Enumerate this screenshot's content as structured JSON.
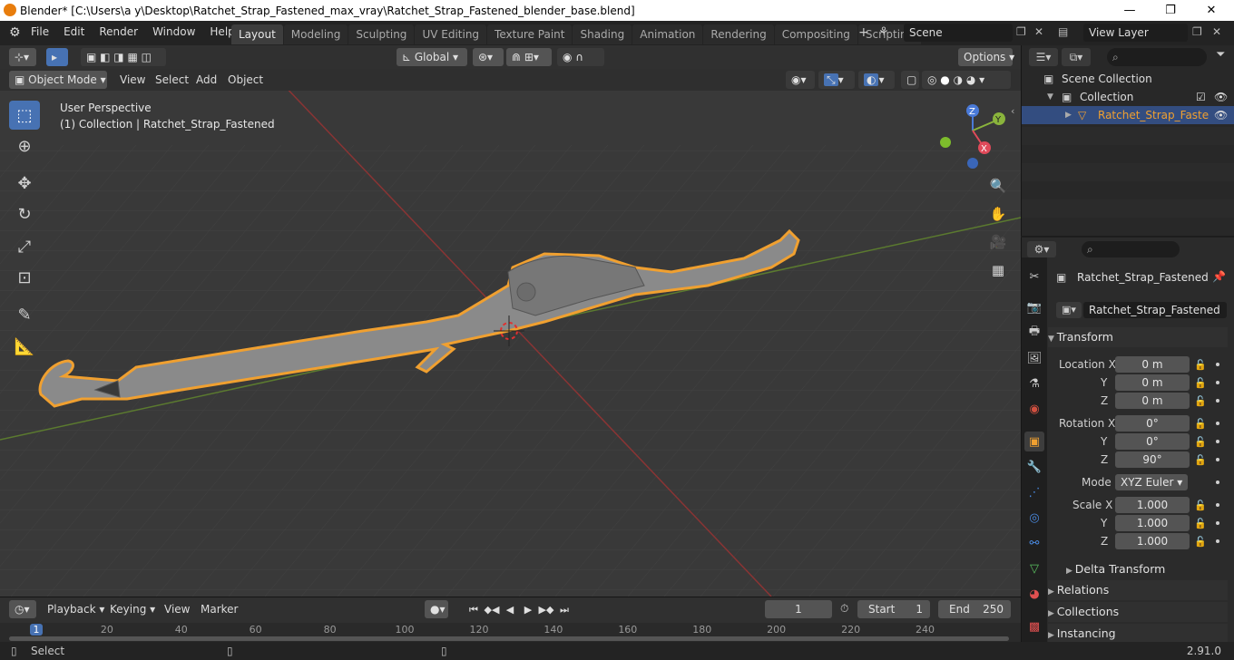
{
  "window": {
    "title": "Blender* [C:\\Users\\a y\\Desktop\\Ratchet_Strap_Fastened_max_vray\\Ratchet_Strap_Fastened_blender_base.blend]",
    "minimize": "—",
    "maximize": "❐",
    "close": "✕"
  },
  "menu": [
    "File",
    "Edit",
    "Render",
    "Window",
    "Help"
  ],
  "workspaces": [
    "Layout",
    "Modeling",
    "Sculpting",
    "UV Editing",
    "Texture Paint",
    "Shading",
    "Animation",
    "Rendering",
    "Compositing",
    "Scripting"
  ],
  "active_workspace": "Layout",
  "scene": {
    "name": "Scene",
    "view_layer": "View Layer"
  },
  "viewport": {
    "mode": "Object Mode",
    "menus": [
      "View",
      "Select",
      "Add",
      "Object"
    ],
    "orientation": "Global",
    "options_label": "Options",
    "info_line1": "User Perspective",
    "info_line2": "(1) Collection | Ratchet_Strap_Fastened",
    "gizmo": {
      "z": "Z",
      "y": "Y",
      "x": "X"
    }
  },
  "outliner": {
    "scene_collection": "Scene Collection",
    "collection": "Collection",
    "object": "Ratchet_Strap_Faste"
  },
  "properties": {
    "object_name": "Ratchet_Strap_Fastened",
    "data_name": "Ratchet_Strap_Fastened",
    "transform_label": "Transform",
    "location_label": "Location X",
    "location": [
      "0 m",
      "0 m",
      "0 m"
    ],
    "rotation_label": "Rotation X",
    "rotation": [
      "0°",
      "0°",
      "90°"
    ],
    "mode_label": "Mode",
    "mode_value": "XYZ Euler",
    "scale_label": "Scale X",
    "scale": [
      "1.000",
      "1.000",
      "1.000"
    ],
    "axis_y": "Y",
    "axis_z": "Z",
    "delta_transform": "Delta Transform",
    "relations": "Relations",
    "collections": "Collections",
    "instancing": "Instancing"
  },
  "timeline": {
    "menus": [
      "Playback",
      "Keying",
      "View",
      "Marker"
    ],
    "current_frame": "1",
    "start_label": "Start",
    "start": "1",
    "end_label": "End",
    "end": "250",
    "ruler_ticks": [
      "1",
      "20",
      "40",
      "60",
      "80",
      "100",
      "120",
      "140",
      "160",
      "180",
      "200",
      "220",
      "240"
    ]
  },
  "status": {
    "left": "Select",
    "version": "2.91.0"
  }
}
